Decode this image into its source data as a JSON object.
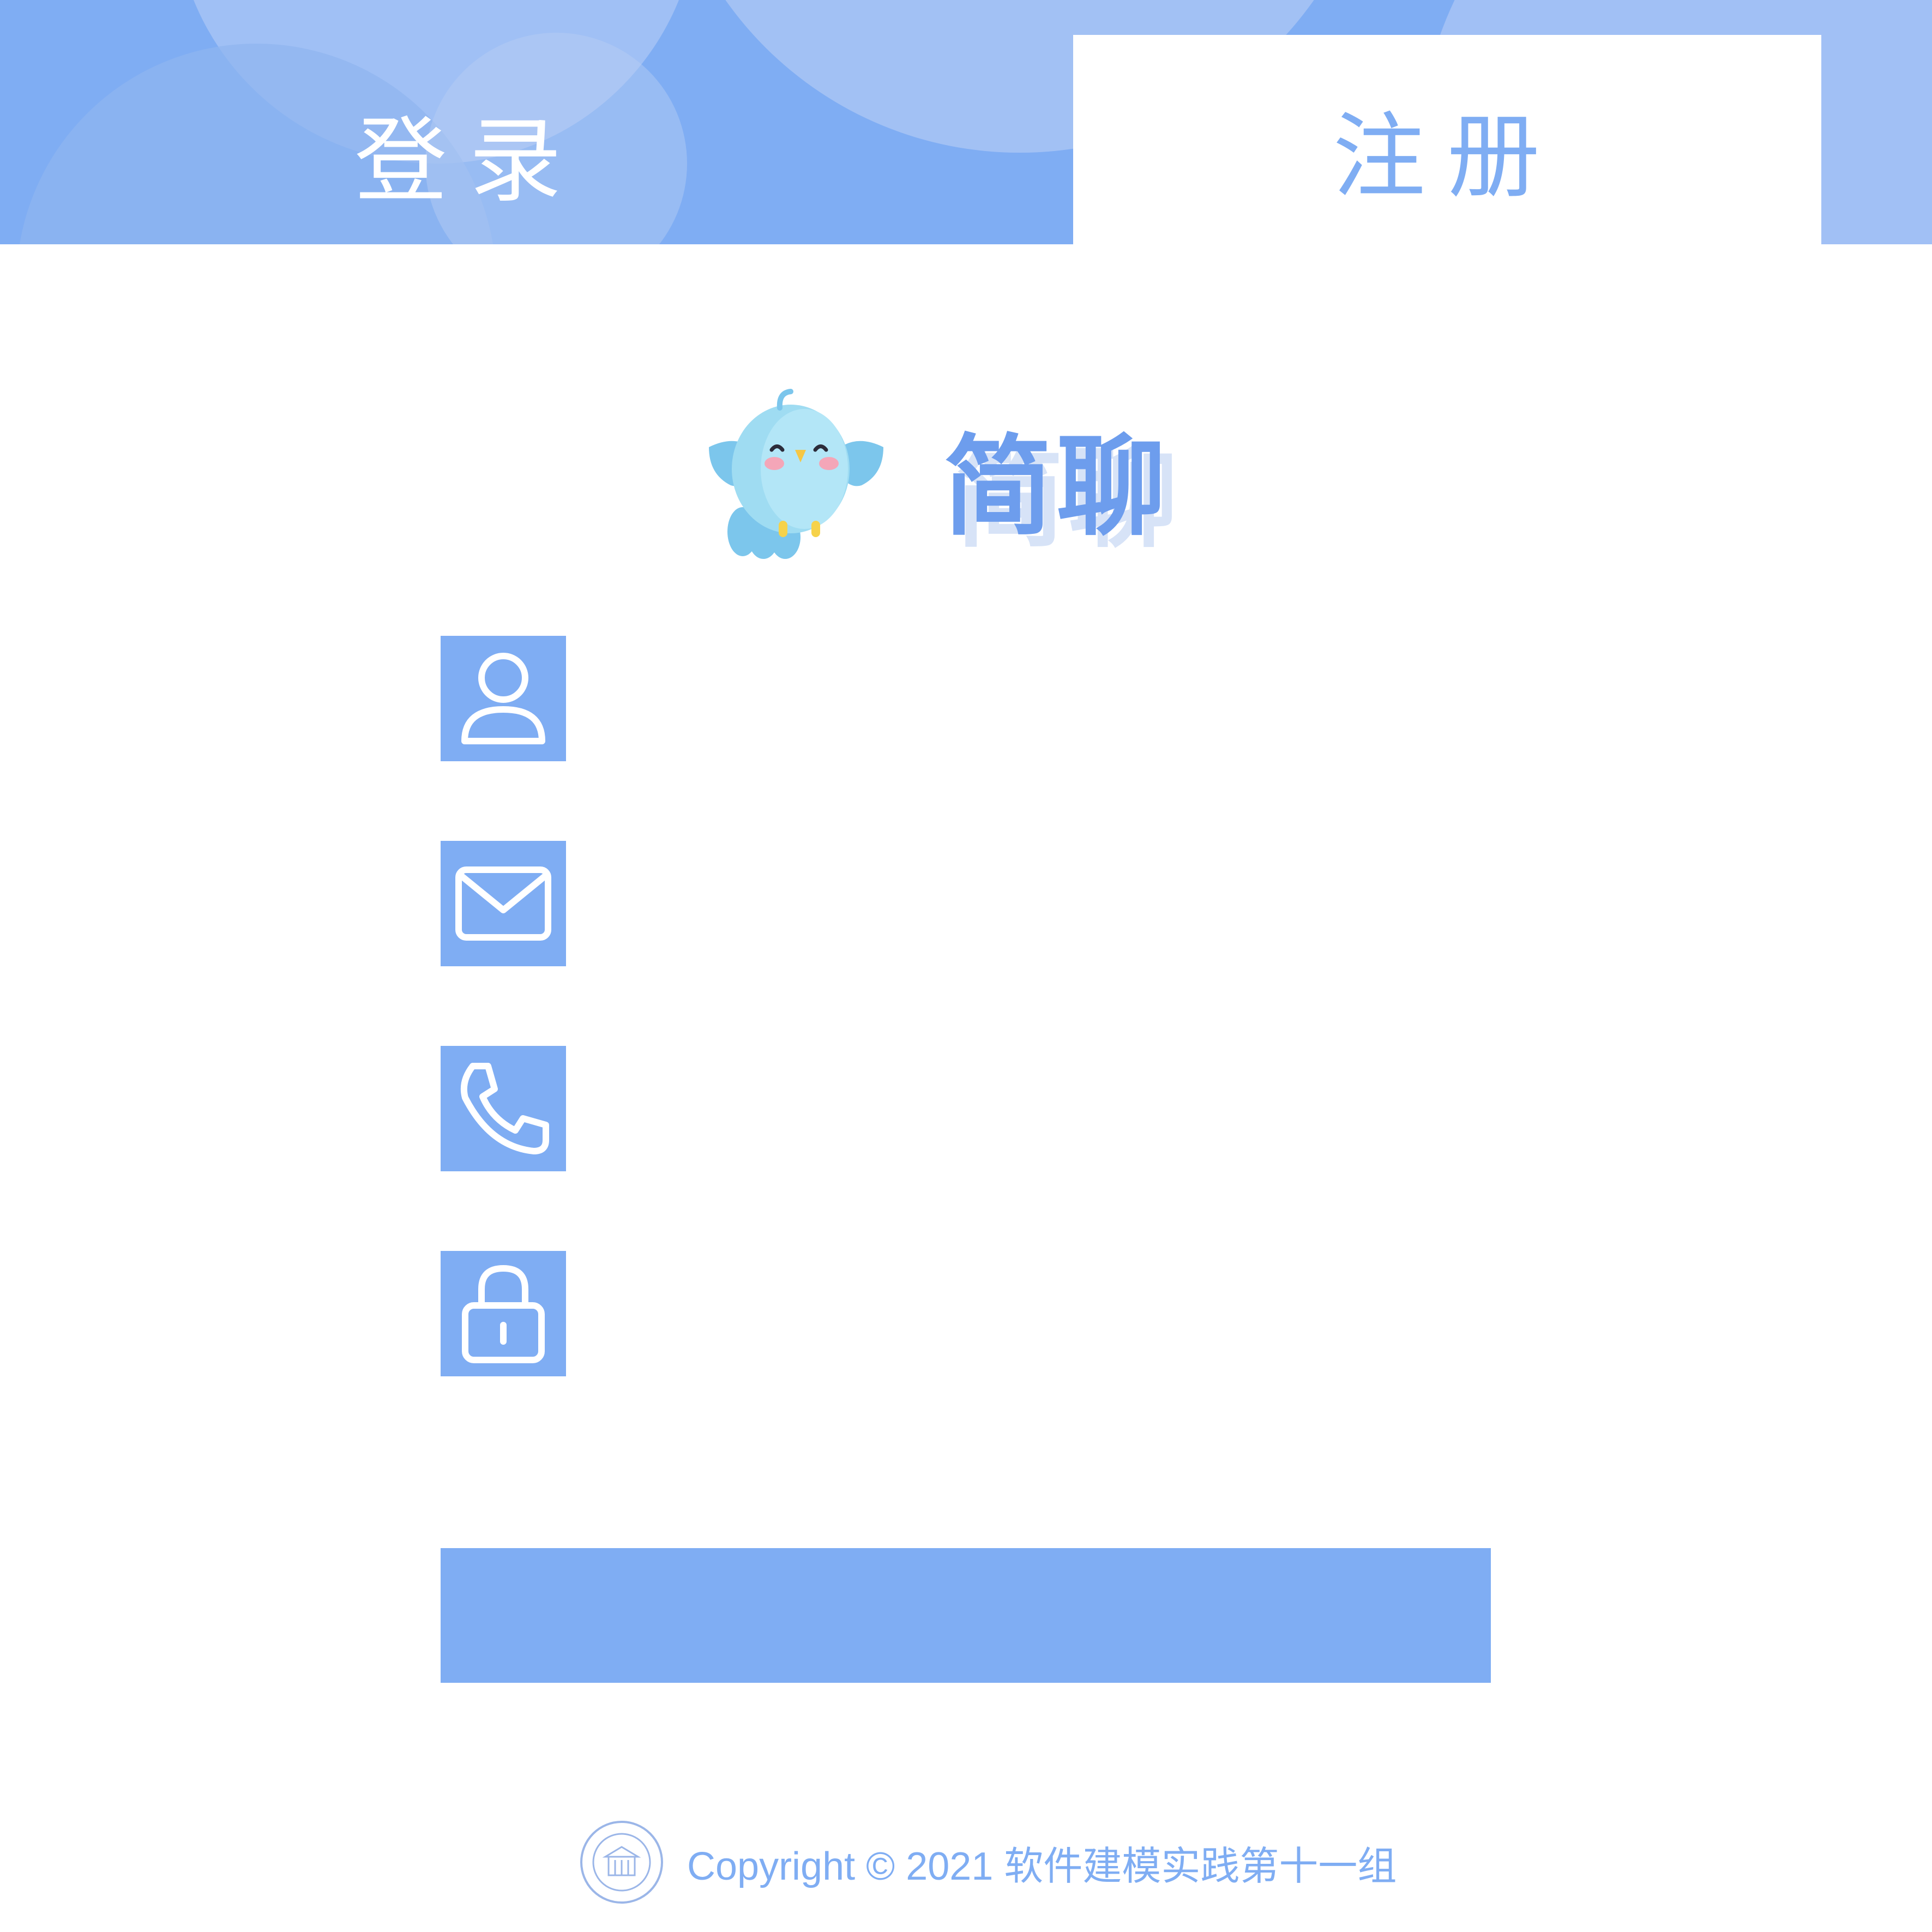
{
  "tabs": {
    "login_label": "登录",
    "register_label": "注册",
    "active": "register"
  },
  "brand": {
    "title": "简聊",
    "mascot_icon": "bird-icon"
  },
  "form": {
    "fields": [
      {
        "icon": "user-icon",
        "value": "",
        "placeholder": ""
      },
      {
        "icon": "mail-icon",
        "value": "",
        "placeholder": ""
      },
      {
        "icon": "phone-icon",
        "value": "",
        "placeholder": ""
      },
      {
        "icon": "lock-icon",
        "value": "",
        "placeholder": ""
      }
    ],
    "submit_label": ""
  },
  "footer": {
    "copyright": "Copyright © 2021 软件建模实践第十一组",
    "logo_icon": "university-seal-icon"
  },
  "colors": {
    "accent": "#7fadf3",
    "accent_light": "#a3c1f4",
    "brand_text": "#6d9ded",
    "background": "#ffffff"
  }
}
